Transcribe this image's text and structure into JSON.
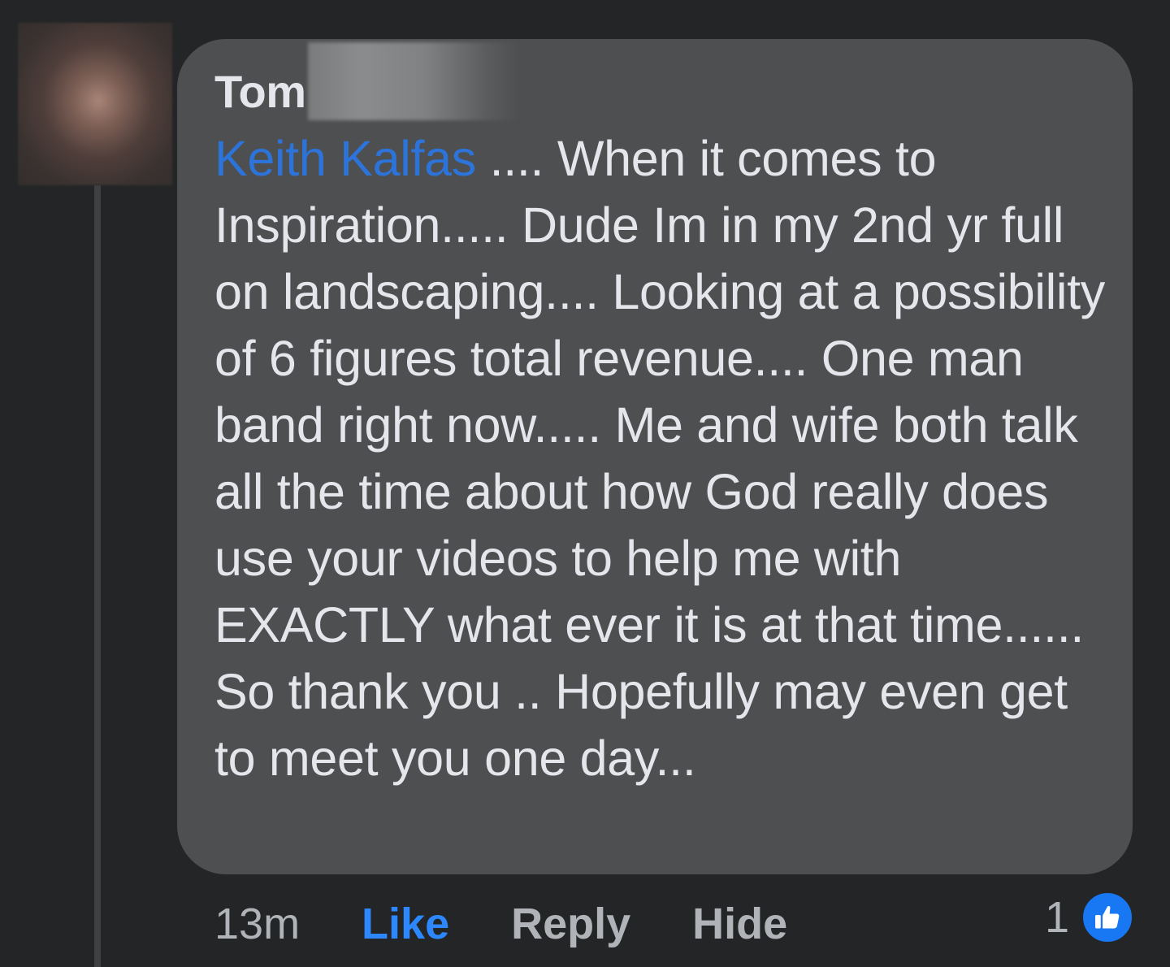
{
  "comment": {
    "author_name": "Tom",
    "mention": "Keith Kalfas",
    "body": " .... When it comes to Inspiration..... Dude Im in my 2nd yr full on landscaping.... Looking at a possibility of 6 figures total revenue.... One man band right now..... Me and wife both talk all the time about how God really does use your videos to help me with EXACTLY what ever it is at that time...... So thank you .. Hopefully may even get to meet you one day..."
  },
  "actions": {
    "time": "13m",
    "like_label": "Like",
    "reply_label": "Reply",
    "hide_label": "Hide"
  },
  "reactions": {
    "count": "1",
    "icon": "thumbs-up-icon",
    "badge_color": "#1877f2"
  },
  "colors": {
    "background": "#242526",
    "bubble": "#4e4f50",
    "mention": "#2d74da",
    "like_active": "#2d88ff",
    "text": "#e4e6eb",
    "secondary_text": "#b0b3b8"
  }
}
